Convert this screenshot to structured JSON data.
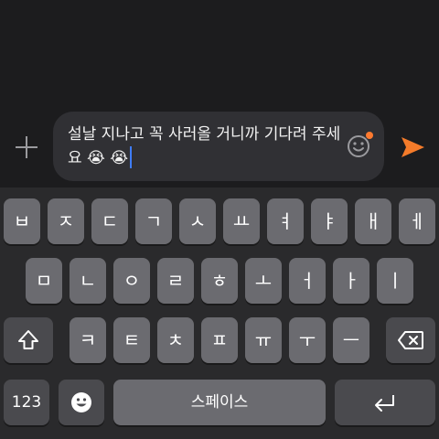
{
  "composer": {
    "text": "설날 지나고 꼭 사러올 거니까 기다려 주세요 😭 😭"
  },
  "keyboard": {
    "row1": [
      "ㅂ",
      "ㅈ",
      "ㄷ",
      "ㄱ",
      "ㅅ",
      "ㅛ",
      "ㅕ",
      "ㅑ",
      "ㅐ",
      "ㅔ"
    ],
    "row2": [
      "ㅁ",
      "ㄴ",
      "ㅇ",
      "ㄹ",
      "ㅎ",
      "ㅗ",
      "ㅓ",
      "ㅏ",
      "ㅣ"
    ],
    "row3": [
      "ㅋ",
      "ㅌ",
      "ㅊ",
      "ㅍ",
      "ㅠ",
      "ㅜ",
      "ㅡ"
    ],
    "numbers_label": "123",
    "space_label": "스페이스"
  },
  "colors": {
    "send_accent": "#f47b2a",
    "notification_dot": "#ff7a2f",
    "caret": "#3f7dff"
  },
  "icons": {
    "plus": "plus-icon",
    "emoji": "smiley-icon",
    "send": "send-icon",
    "shift": "shift-icon",
    "backspace": "backspace-icon",
    "emoji_key": "emoji-face-icon",
    "return": "return-icon"
  }
}
